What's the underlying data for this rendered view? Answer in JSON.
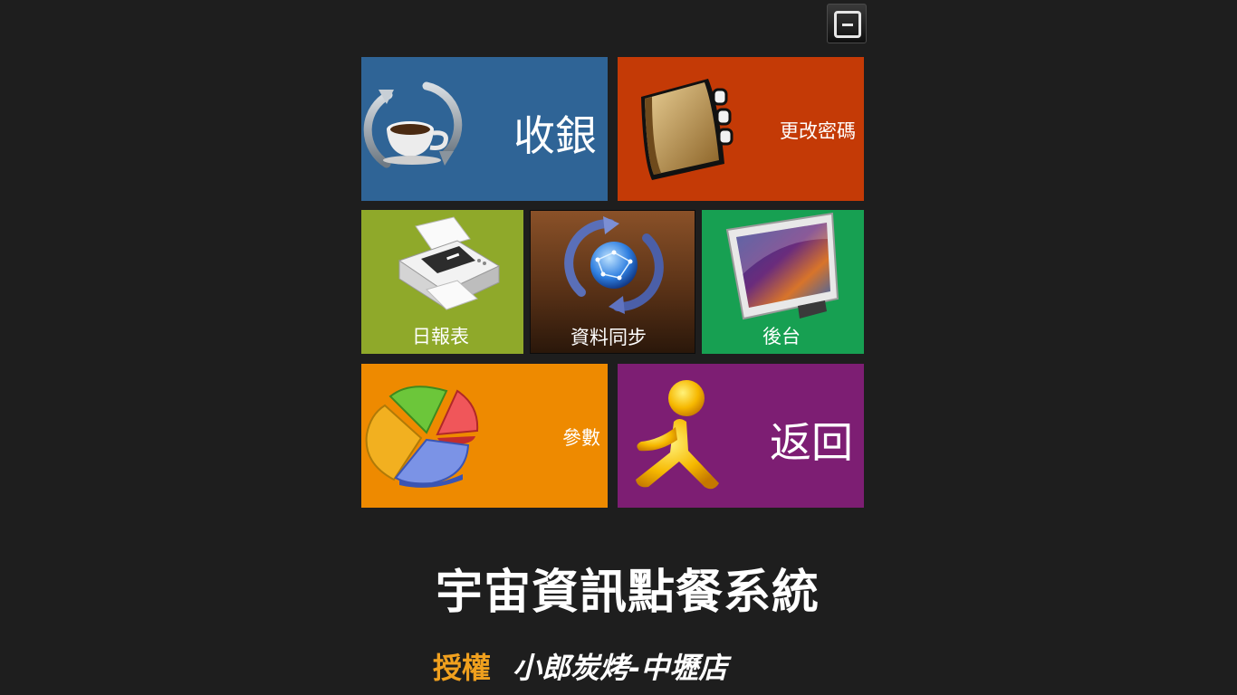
{
  "window": {
    "minimize_icon": "minimize-icon"
  },
  "tiles": {
    "cashier": {
      "label": "收銀",
      "color": "#2f6496",
      "icon": "coffee-cup-refresh-icon"
    },
    "password": {
      "label": "更改密碼",
      "color": "#c43a06",
      "icon": "address-book-icon"
    },
    "report": {
      "label": "日報表",
      "color": "#8fa92a",
      "icon": "printer-icon"
    },
    "sync": {
      "label": "資料同步",
      "color": "#6b3d1c",
      "icon": "globe-sync-icon"
    },
    "admin": {
      "label": "後台",
      "color": "#17a052",
      "icon": "monitor-icon"
    },
    "params": {
      "label": "參數",
      "color": "#ee8a00",
      "icon": "pie-chart-icon"
    },
    "back": {
      "label": "返回",
      "color": "#7d1e73",
      "icon": "running-man-icon"
    }
  },
  "footer": {
    "title": "宇宙資訊點餐系統",
    "license_label": "授權",
    "store_name": "小郎炭烤-中壢店",
    "license_label_color": "#f0a01e"
  }
}
